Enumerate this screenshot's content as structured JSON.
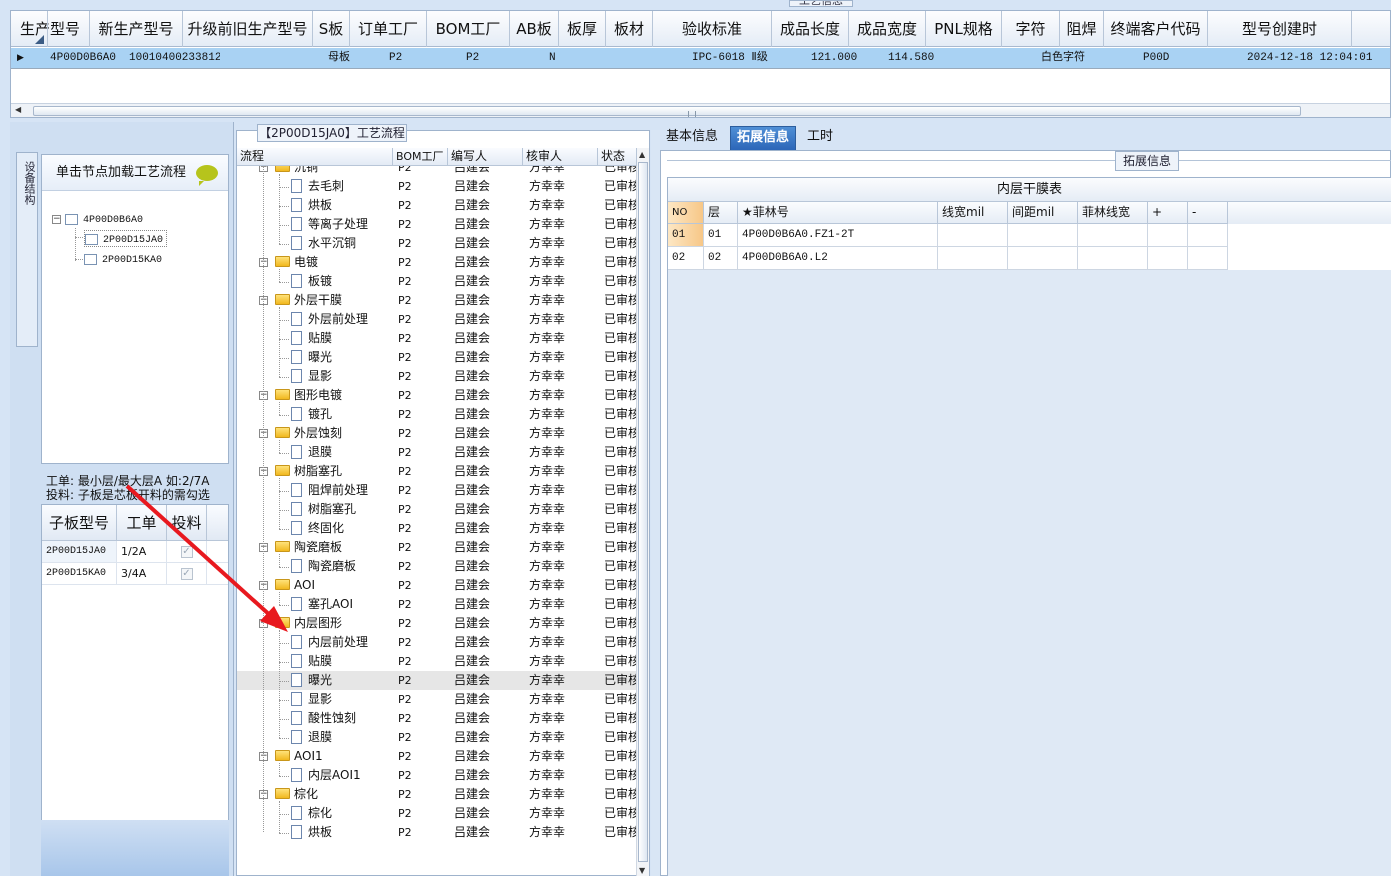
{
  "top_grid": {
    "title": "工艺信息",
    "columns": [
      {
        "label": "生产型号",
        "w": 79
      },
      {
        "label": "新生产型号",
        "w": 93
      },
      {
        "label": "升级前旧生产型号",
        "w": 130
      },
      {
        "label": "S板",
        "w": 37
      },
      {
        "label": "订单工厂",
        "w": 77
      },
      {
        "label": "BOM工厂",
        "w": 83
      },
      {
        "label": "AB板",
        "w": 49
      },
      {
        "label": "板厚",
        "w": 47
      },
      {
        "label": "板材",
        "w": 47
      },
      {
        "label": "验收标准",
        "w": 119
      },
      {
        "label": "成品长度",
        "w": 77
      },
      {
        "label": "成品宽度",
        "w": 77
      },
      {
        "label": "PNL规格",
        "w": 76
      },
      {
        "label": "字符",
        "w": 58
      },
      {
        "label": "阻焊",
        "w": 44
      },
      {
        "label": "终端客户代码",
        "w": 104
      },
      {
        "label": "型号创建时",
        "w": 144
      }
    ],
    "row": [
      "4P00D0B6A0",
      "10010400233812",
      "母板",
      "",
      "P2",
      "P2",
      "N",
      "",
      "",
      "IPC-6018 Ⅱ级",
      "121.000",
      "114.580",
      "",
      "白色字符",
      "",
      "P00D",
      "2024-12-18 12:04:01"
    ]
  },
  "left_panel": {
    "vertical_tab": "设备结构",
    "node_header": "单击节点加载工艺流程",
    "tree": {
      "root": "4P00D0B6A0",
      "children": [
        "2P00D15JA0",
        "2P00D15KA0"
      ]
    },
    "hint_line1": "工单: 最小层/最大层A 如:2/7A",
    "hint_line2": "投料: 子板是芯板开料的需勾选",
    "sub_grid": {
      "columns": [
        "子板型号",
        "工单",
        "投料"
      ],
      "rows": [
        {
          "model": "2P00D15JA0",
          "order": "1/2A",
          "checked": true
        },
        {
          "model": "2P00D15KA0",
          "order": "3/4A",
          "checked": true
        }
      ]
    }
  },
  "process_panel": {
    "title": "【2P00D15JA0】工艺流程",
    "columns": [
      "流程",
      "BOM工厂",
      "编写人",
      "核审人",
      "状态"
    ],
    "rows": [
      {
        "name": "沉铜",
        "type": "group",
        "bom": "P2",
        "editor": "吕建会",
        "reviewer": "方幸幸",
        "status": "已审核"
      },
      {
        "name": "去毛刺",
        "type": "leaf",
        "bom": "P2",
        "editor": "吕建会",
        "reviewer": "方幸幸",
        "status": "已审核"
      },
      {
        "name": "烘板",
        "type": "leaf",
        "bom": "P2",
        "editor": "吕建会",
        "reviewer": "方幸幸",
        "status": "已审核"
      },
      {
        "name": "等离子处理",
        "type": "leaf",
        "bom": "P2",
        "editor": "吕建会",
        "reviewer": "方幸幸",
        "status": "已审核"
      },
      {
        "name": "水平沉铜",
        "type": "leaf",
        "bom": "P2",
        "editor": "吕建会",
        "reviewer": "方幸幸",
        "status": "已审核"
      },
      {
        "name": "电镀",
        "type": "group",
        "bom": "P2",
        "editor": "吕建会",
        "reviewer": "方幸幸",
        "status": "已审核"
      },
      {
        "name": "板镀",
        "type": "leaf",
        "bom": "P2",
        "editor": "吕建会",
        "reviewer": "方幸幸",
        "status": "已审核"
      },
      {
        "name": "外层干膜",
        "type": "group",
        "bom": "P2",
        "editor": "吕建会",
        "reviewer": "方幸幸",
        "status": "已审核"
      },
      {
        "name": "外层前处理",
        "type": "leaf",
        "bom": "P2",
        "editor": "吕建会",
        "reviewer": "方幸幸",
        "status": "已审核"
      },
      {
        "name": "贴膜",
        "type": "leaf",
        "bom": "P2",
        "editor": "吕建会",
        "reviewer": "方幸幸",
        "status": "已审核"
      },
      {
        "name": "曝光",
        "type": "leaf",
        "bom": "P2",
        "editor": "吕建会",
        "reviewer": "方幸幸",
        "status": "已审核"
      },
      {
        "name": "显影",
        "type": "leaf",
        "bom": "P2",
        "editor": "吕建会",
        "reviewer": "方幸幸",
        "status": "已审核"
      },
      {
        "name": "图形电镀",
        "type": "group",
        "bom": "P2",
        "editor": "吕建会",
        "reviewer": "方幸幸",
        "status": "已审核"
      },
      {
        "name": "镀孔",
        "type": "leaf",
        "bom": "P2",
        "editor": "吕建会",
        "reviewer": "方幸幸",
        "status": "已审核"
      },
      {
        "name": "外层蚀刻",
        "type": "group",
        "bom": "P2",
        "editor": "吕建会",
        "reviewer": "方幸幸",
        "status": "已审核"
      },
      {
        "name": "退膜",
        "type": "leaf",
        "bom": "P2",
        "editor": "吕建会",
        "reviewer": "方幸幸",
        "status": "已审核"
      },
      {
        "name": "树脂塞孔",
        "type": "group",
        "bom": "P2",
        "editor": "吕建会",
        "reviewer": "方幸幸",
        "status": "已审核"
      },
      {
        "name": "阻焊前处理",
        "type": "leaf",
        "bom": "P2",
        "editor": "吕建会",
        "reviewer": "方幸幸",
        "status": "已审核"
      },
      {
        "name": "树脂塞孔",
        "type": "leaf",
        "bom": "P2",
        "editor": "吕建会",
        "reviewer": "方幸幸",
        "status": "已审核"
      },
      {
        "name": "终固化",
        "type": "leaf",
        "bom": "P2",
        "editor": "吕建会",
        "reviewer": "方幸幸",
        "status": "已审核"
      },
      {
        "name": "陶瓷磨板",
        "type": "group",
        "bom": "P2",
        "editor": "吕建会",
        "reviewer": "方幸幸",
        "status": "已审核"
      },
      {
        "name": "陶瓷磨板",
        "type": "leaf",
        "bom": "P2",
        "editor": "吕建会",
        "reviewer": "方幸幸",
        "status": "已审核"
      },
      {
        "name": "AOI",
        "type": "group",
        "bom": "P2",
        "editor": "吕建会",
        "reviewer": "方幸幸",
        "status": "已审核"
      },
      {
        "name": "塞孔AOI",
        "type": "leaf",
        "bom": "P2",
        "editor": "吕建会",
        "reviewer": "方幸幸",
        "status": "已审核"
      },
      {
        "name": "内层图形",
        "type": "group",
        "bom": "P2",
        "editor": "吕建会",
        "reviewer": "方幸幸",
        "status": "已审核"
      },
      {
        "name": "内层前处理",
        "type": "leaf",
        "bom": "P2",
        "editor": "吕建会",
        "reviewer": "方幸幸",
        "status": "已审核"
      },
      {
        "name": "贴膜",
        "type": "leaf",
        "bom": "P2",
        "editor": "吕建会",
        "reviewer": "方幸幸",
        "status": "已审核"
      },
      {
        "name": "曝光",
        "type": "leaf",
        "bom": "P2",
        "editor": "吕建会",
        "reviewer": "方幸幸",
        "status": "已审核",
        "selected": true
      },
      {
        "name": "显影",
        "type": "leaf",
        "bom": "P2",
        "editor": "吕建会",
        "reviewer": "方幸幸",
        "status": "已审核"
      },
      {
        "name": "酸性蚀刻",
        "type": "leaf",
        "bom": "P2",
        "editor": "吕建会",
        "reviewer": "方幸幸",
        "status": "已审核"
      },
      {
        "name": "退膜",
        "type": "leaf",
        "bom": "P2",
        "editor": "吕建会",
        "reviewer": "方幸幸",
        "status": "已审核"
      },
      {
        "name": "AOI1",
        "type": "group",
        "bom": "P2",
        "editor": "吕建会",
        "reviewer": "方幸幸",
        "status": "已审核"
      },
      {
        "name": "内层AOI1",
        "type": "leaf",
        "bom": "P2",
        "editor": "吕建会",
        "reviewer": "方幸幸",
        "status": "已审核"
      },
      {
        "name": "棕化",
        "type": "group",
        "bom": "P2",
        "editor": "吕建会",
        "reviewer": "方幸幸",
        "status": "已审核"
      },
      {
        "name": "棕化",
        "type": "leaf",
        "bom": "P2",
        "editor": "吕建会",
        "reviewer": "方幸幸",
        "status": "已审核"
      },
      {
        "name": "烘板",
        "type": "leaf",
        "bom": "P2",
        "editor": "吕建会",
        "reviewer": "方幸幸",
        "status": "已审核"
      }
    ]
  },
  "right_panel": {
    "tabs": [
      {
        "label": "基本信息",
        "active": false
      },
      {
        "label": "拓展信息",
        "active": true
      },
      {
        "label": "工时",
        "active": false
      }
    ],
    "section_title": "拓展信息",
    "grid_title": "内层干膜表",
    "columns": [
      "NO",
      "层",
      "★菲林号",
      "线宽mil",
      "间距mil",
      "菲林线宽",
      "+",
      "-"
    ],
    "rows": [
      [
        "01",
        "01",
        "4P00D0B6A0.FZ1-2T",
        "",
        "",
        "",
        "",
        ""
      ],
      [
        "02",
        "02",
        "4P00D0B6A0.L2",
        "",
        "",
        "",
        "",
        ""
      ]
    ]
  },
  "colors": {
    "selected_row": "#a9d2f3",
    "accent": "#2c66b8",
    "arrow": "#e8191f"
  }
}
